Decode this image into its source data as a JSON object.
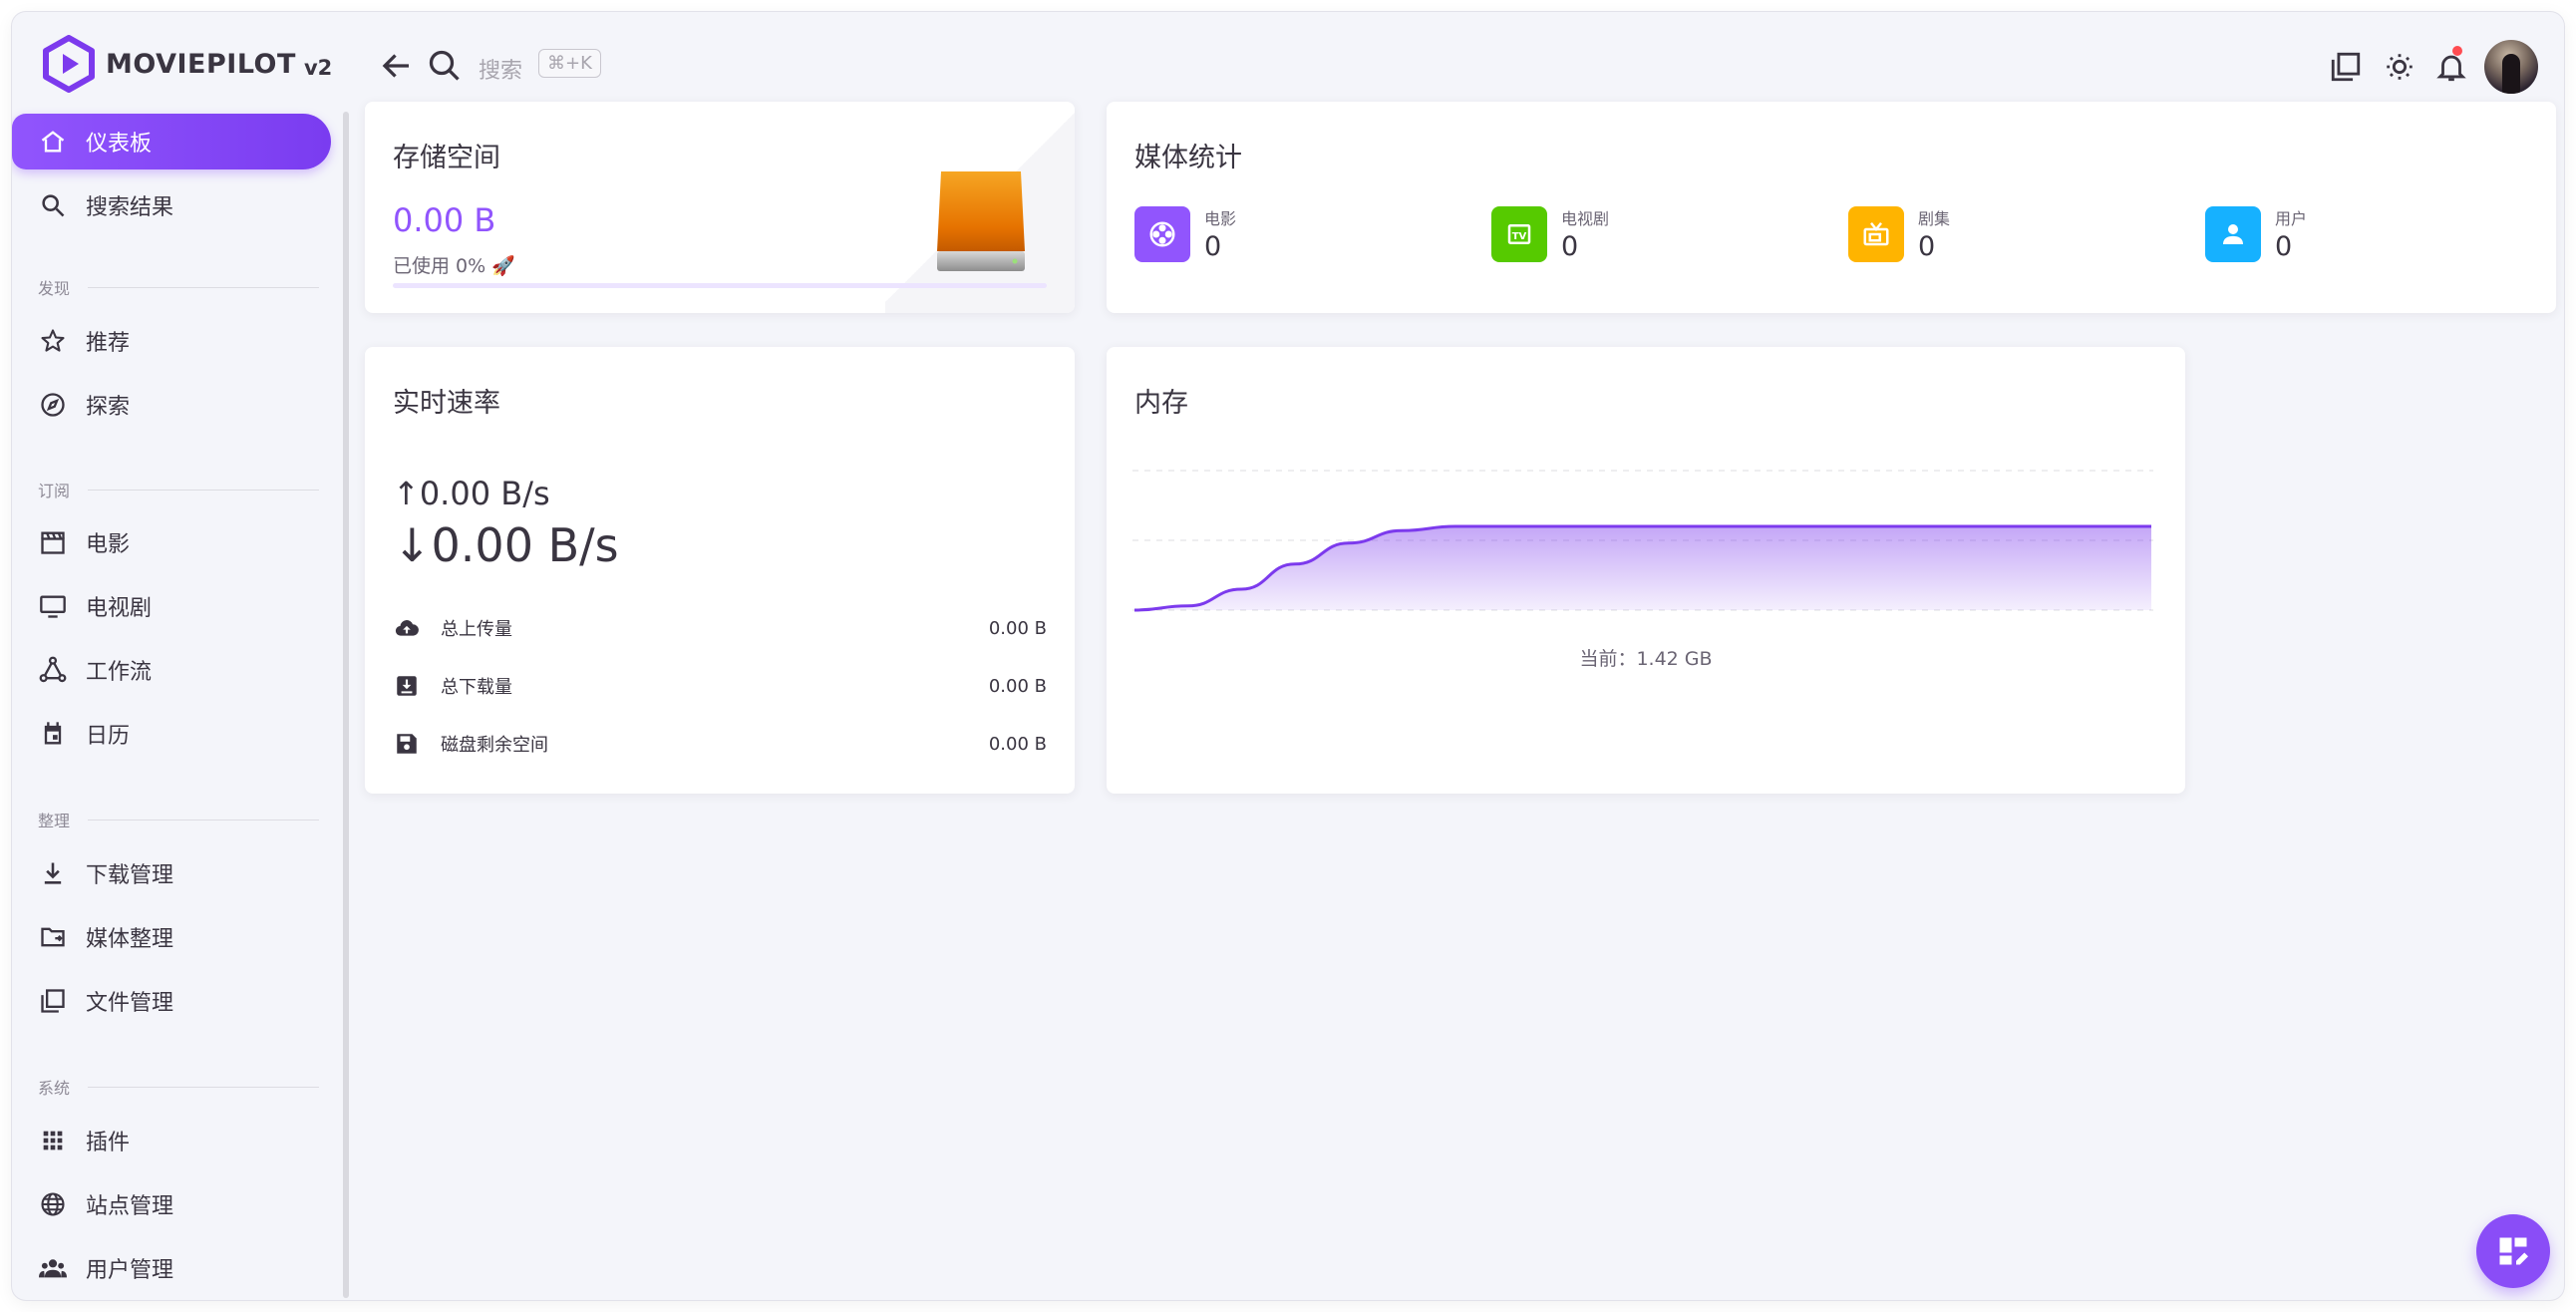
{
  "app": {
    "name": "MOVIEPILOT",
    "version": "v2"
  },
  "topbar": {
    "search_placeholder": "搜索",
    "search_shortcut": "⌘+K"
  },
  "sidebar": {
    "items": [
      {
        "label": "仪表板",
        "icon": "home-icon"
      },
      {
        "label": "搜索结果",
        "icon": "search-icon"
      }
    ],
    "sections": [
      {
        "title": "发现",
        "items": [
          {
            "label": "推荐",
            "icon": "star-icon"
          },
          {
            "label": "探索",
            "icon": "compass-icon"
          }
        ]
      },
      {
        "title": "订阅",
        "items": [
          {
            "label": "电影",
            "icon": "movie-clapper-icon"
          },
          {
            "label": "电视剧",
            "icon": "monitor-icon"
          },
          {
            "label": "工作流",
            "icon": "workflow-icon"
          },
          {
            "label": "日历",
            "icon": "calendar-icon"
          }
        ]
      },
      {
        "title": "整理",
        "items": [
          {
            "label": "下载管理",
            "icon": "download-icon"
          },
          {
            "label": "媒体整理",
            "icon": "folder-move-icon"
          },
          {
            "label": "文件管理",
            "icon": "file-copy-icon"
          }
        ]
      },
      {
        "title": "系统",
        "items": [
          {
            "label": "插件",
            "icon": "apps-grid-icon"
          },
          {
            "label": "站点管理",
            "icon": "globe-icon"
          },
          {
            "label": "用户管理",
            "icon": "users-icon"
          }
        ]
      }
    ]
  },
  "storage": {
    "title": "存储空间",
    "value": "0.00 B",
    "used_text": "已使用 0% 🚀",
    "used_fraction": 0.0
  },
  "media_stats": {
    "title": "媒体统计",
    "items": [
      {
        "label": "电影",
        "value": "0",
        "color": "#9155fd",
        "icon": "film-reel-icon"
      },
      {
        "label": "电视剧",
        "value": "0",
        "color": "#56ca00",
        "icon": "tv-badge-icon"
      },
      {
        "label": "剧集",
        "value": "0",
        "color": "#ffb400",
        "icon": "tv-retro-icon"
      },
      {
        "label": "用户",
        "value": "0",
        "color": "#16b1ff",
        "icon": "user-icon"
      }
    ]
  },
  "speed": {
    "title": "实时速率",
    "upload": "↑0.00 B/s",
    "download": "↓0.00 B/s",
    "rows": [
      {
        "label": "总上传量",
        "value": "0.00 B",
        "icon": "cloud-upload-icon"
      },
      {
        "label": "总下载量",
        "value": "0.00 B",
        "icon": "inbox-download-icon"
      },
      {
        "label": "磁盘剩余空间",
        "value": "0.00 B",
        "icon": "floppy-disk-icon"
      }
    ]
  },
  "memory": {
    "title": "内存",
    "current_text": "当前：1.42 GB",
    "chart_data": {
      "type": "area",
      "series": [
        {
          "values": [
            0.0,
            0.05,
            0.25,
            0.55,
            0.8,
            0.95,
            1.0,
            1.0,
            1.0,
            1.0,
            1.0,
            1.0,
            1.0,
            1.0,
            1.0,
            1.0,
            1.0,
            1.0,
            1.0,
            1.0
          ]
        }
      ],
      "color": "#7c3aed",
      "grid": true
    }
  },
  "colors": {
    "accent": "#9155fd"
  }
}
